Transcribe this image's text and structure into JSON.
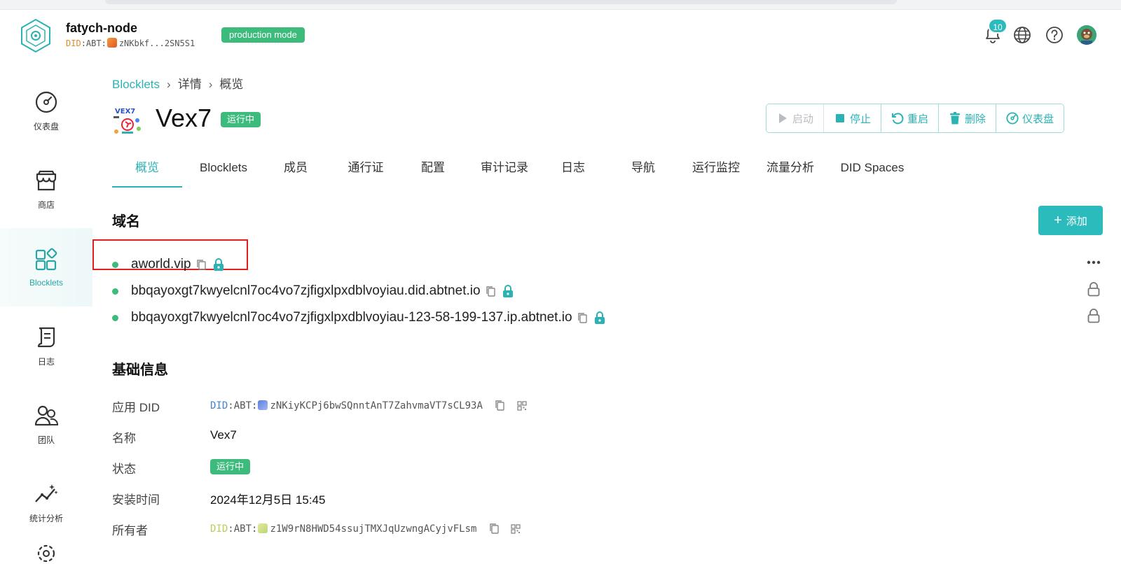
{
  "header": {
    "node_name": "fatych-node",
    "did_prefix": "DID",
    "did_mid": ":ABT:",
    "did_value": "zNKbkf...2SN5S1",
    "mode_badge": "production mode",
    "notification_count": "10"
  },
  "sidebar": {
    "items": [
      {
        "label": "仪表盘",
        "icon": "dashboard-gauge-icon"
      },
      {
        "label": "商店",
        "icon": "store-icon"
      },
      {
        "label": "Blocklets",
        "icon": "blocklets-grid-icon",
        "active": true
      },
      {
        "label": "日志",
        "icon": "log-scroll-icon"
      },
      {
        "label": "团队",
        "icon": "team-icon"
      },
      {
        "label": "统计分析",
        "icon": "analytics-icon"
      }
    ]
  },
  "breadcrumb": [
    "Blocklets",
    "详情",
    "概览"
  ],
  "app": {
    "title": "Vex7",
    "status": "运行中"
  },
  "actions": {
    "start": "启动",
    "stop": "停止",
    "restart": "重启",
    "delete": "删除",
    "dashboard": "仪表盘"
  },
  "tabs": [
    "概览",
    "Blocklets",
    "成员",
    "通行证",
    "配置",
    "审计记录",
    "日志",
    "导航",
    "运行监控",
    "流量分析",
    "DID Spaces"
  ],
  "domains": {
    "title": "域名",
    "add_label": "添加",
    "items": [
      "aworld.vip",
      "bbqayoxgt7kwyelcnl7oc4vo7zjfigxlpxdblvoyiau.did.abtnet.io",
      "bbqayoxgt7kwyelcnl7oc4vo7zjfigxlpxdblvoyiau-123-58-199-137.ip.abtnet.io"
    ]
  },
  "basic_info": {
    "title": "基础信息",
    "app_did_label": "应用 DID",
    "app_did_prefix": "DID",
    "app_did_mid": ":ABT:",
    "app_did_value": "zNKiyKCPj6bwSQnntAnT7ZahvmaVT7sCL93A",
    "name_label": "名称",
    "name_value": "Vex7",
    "status_label": "状态",
    "status_value": "运行中",
    "installed_label": "安装时间",
    "installed_value": "2024年12月5日 15:45",
    "owner_label": "所有者",
    "owner_did_prefix": "DID",
    "owner_did_mid": ":ABT:",
    "owner_did_value": "z1W9rN8HWD54ssujTMXJqUzwngACyjvFLsm"
  },
  "colors": {
    "accent": "#2bb3b4",
    "status_green": "#3dbb7c",
    "highlight_red": "#e02020"
  }
}
